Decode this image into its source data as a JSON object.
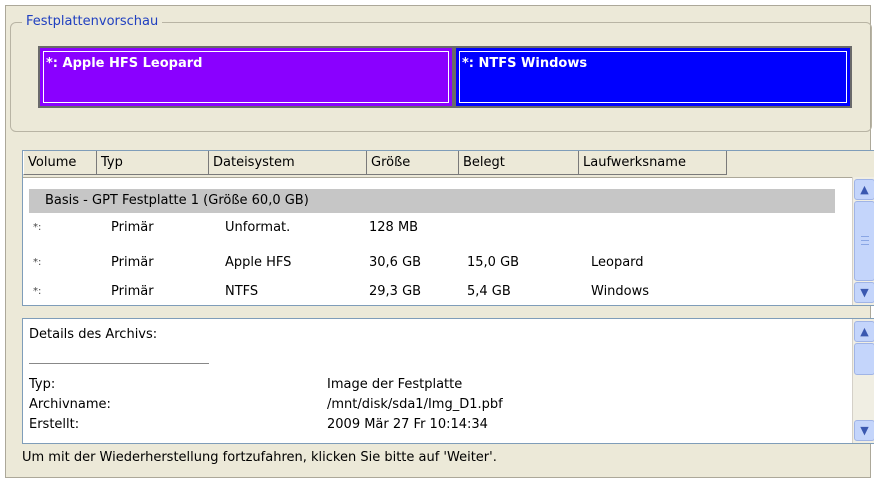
{
  "disk_preview": {
    "title": "Festplattenvorschau",
    "partitions": [
      {
        "label": "*: Apple HFS Leopard",
        "color": "#8a00ff"
      },
      {
        "label": "*: NTFS Windows",
        "color": "#0000ff"
      }
    ]
  },
  "volumes": {
    "columns": [
      "Volume",
      "Typ",
      "Dateisystem",
      "Größe",
      "Belegt",
      "Laufwerksname"
    ],
    "group_label": "Basis - GPT Festplatte 1 (Größe 60,0 GB)",
    "rows": [
      {
        "volume": "*:",
        "typ": "Primär",
        "fs": "Unformat.",
        "size": "128 MB",
        "used": "",
        "name": ""
      },
      {
        "volume": "*:",
        "typ": "Primär",
        "fs": "Apple HFS",
        "size": "30,6 GB",
        "used": "15,0 GB",
        "name": "Leopard"
      },
      {
        "volume": "*:",
        "typ": "Primär",
        "fs": "NTFS",
        "size": "29,3 GB",
        "used": "5,4 GB",
        "name": "Windows"
      }
    ]
  },
  "details": {
    "heading": "Details des Archivs:",
    "items": [
      {
        "key": "Typ:",
        "value": "Image der Festplatte"
      },
      {
        "key": "Archivname:",
        "value": "/mnt/disk/sda1/Img_D1.pbf"
      },
      {
        "key": "Erstellt:",
        "value": "2009 Mär 27 Fr 10:14:34"
      }
    ]
  },
  "footer_text": "Um mit der Wiederherstellung fortzufahren, klicken Sie bitte auf 'Weiter'.",
  "icons": {
    "scroll_up": "▲",
    "scroll_down": "▼"
  }
}
